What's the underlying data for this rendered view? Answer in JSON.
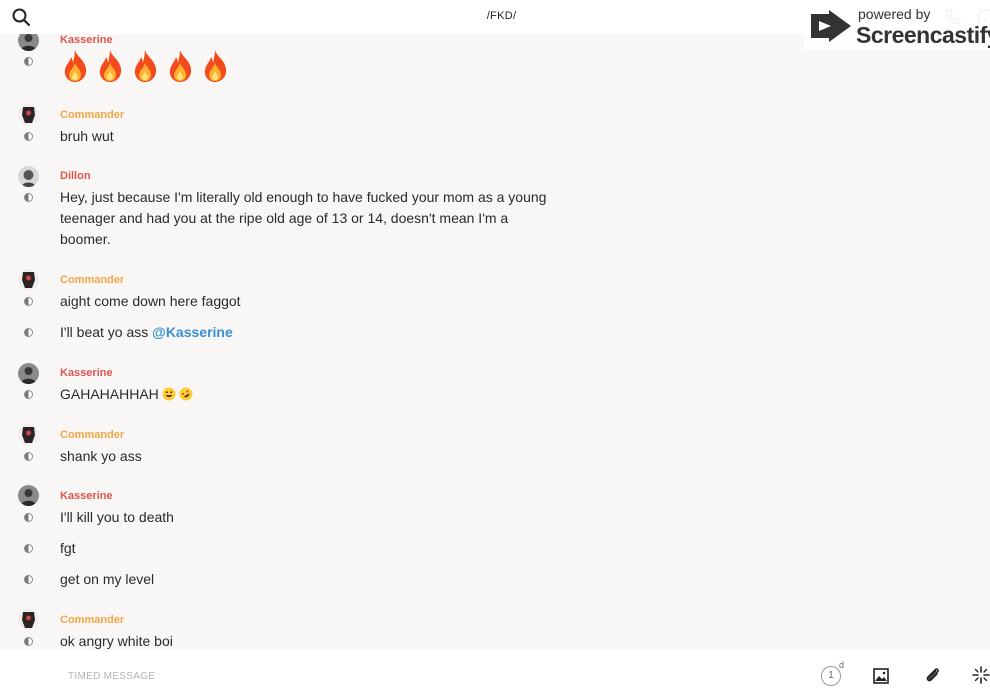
{
  "header": {
    "title": "/FKD/",
    "search_icon": "search-icon",
    "call_icon": "phone-icon",
    "info_icon": "info-icon"
  },
  "watermark": {
    "line1": "powered by",
    "line2": "Screencastify"
  },
  "colors": {
    "kasserine": "#e0554c",
    "commander": "#f2a448",
    "dillon": "#e0554c",
    "mention": "#3a8fd1"
  },
  "messages": [
    {
      "sender": "Kasserine",
      "lines": [
        "🔥🔥🔥🔥🔥"
      ]
    },
    {
      "sender": "Commander",
      "lines": [
        "bruh wut"
      ]
    },
    {
      "sender": "Dillon",
      "lines": [
        "Hey, just because I'm literally old enough to have fucked your mom as a young teenager and had you at the ripe old age of 13 or 14, doesn't mean I'm a boomer."
      ]
    },
    {
      "sender": "Commander",
      "lines": [
        "aight come down here faggot",
        "I'll beat yo ass @Kasserine"
      ]
    },
    {
      "sender": "Kasserine",
      "lines": [
        "GAHAHAHHAH 😃 🤣"
      ]
    },
    {
      "sender": "Commander",
      "lines": [
        "shank yo ass"
      ]
    },
    {
      "sender": "Kasserine",
      "lines": [
        "I'll kill you to death",
        "fgt",
        "get on my level"
      ]
    },
    {
      "sender": "Commander",
      "lines": [
        "ok angry white boi"
      ]
    }
  ],
  "mention_text": {
    "prefix": "I'll beat yo ass ",
    "mention": "@Kasserine"
  },
  "gahaha_text": "GAHAHAHHAH",
  "composer": {
    "placeholder": "TIMED MESSAGE",
    "timer_value": "1",
    "timer_unit": "d"
  }
}
